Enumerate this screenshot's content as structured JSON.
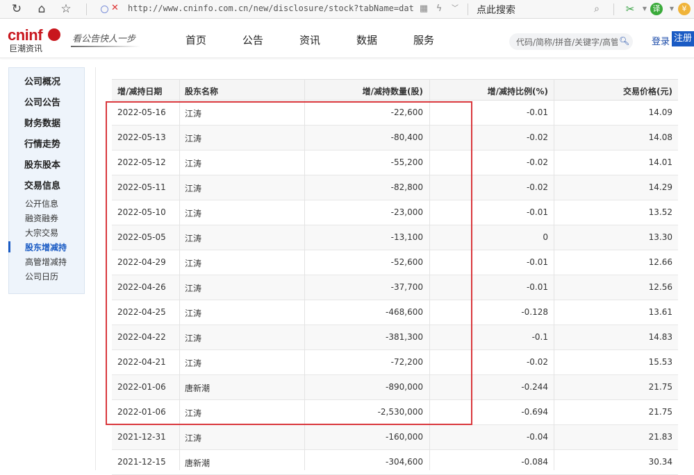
{
  "browser": {
    "url": "http://www.cninfo.com.cn/new/disclosure/stock?tabName=dat",
    "search_hint": "点此搜索"
  },
  "header": {
    "logo_text": "cninf",
    "logo_sub": "巨潮资讯",
    "slogan": "看公告快人一步",
    "nav": [
      "首页",
      "公告",
      "资讯",
      "数据",
      "服务"
    ],
    "search_placeholder": "代码/简称/拼音/关键字/高管",
    "login": "登录",
    "register": "注册"
  },
  "sidebar": {
    "main_items": [
      "公司概况",
      "公司公告",
      "财务数据",
      "行情走势",
      "股东股本",
      "交易信息"
    ],
    "sub_items": [
      "公开信息",
      "融资融券",
      "大宗交易",
      "股东增减持",
      "高管增减持",
      "公司日历"
    ],
    "active_sub": "股东增减持"
  },
  "table": {
    "columns": [
      "增/减持日期",
      "股东名称",
      "增/减持数量(股)",
      "增/减持比例(%)",
      "交易价格(元)"
    ],
    "rows": [
      [
        "2022-05-16",
        "江涛",
        "-22,600",
        "-0.01",
        "14.09"
      ],
      [
        "2022-05-13",
        "江涛",
        "-80,400",
        "-0.02",
        "14.08"
      ],
      [
        "2022-05-12",
        "江涛",
        "-55,200",
        "-0.02",
        "14.01"
      ],
      [
        "2022-05-11",
        "江涛",
        "-82,800",
        "-0.02",
        "14.29"
      ],
      [
        "2022-05-10",
        "江涛",
        "-23,000",
        "-0.01",
        "13.52"
      ],
      [
        "2022-05-05",
        "江涛",
        "-13,100",
        "0",
        "13.30"
      ],
      [
        "2022-04-29",
        "江涛",
        "-52,600",
        "-0.01",
        "12.66"
      ],
      [
        "2022-04-26",
        "江涛",
        "-37,700",
        "-0.01",
        "12.56"
      ],
      [
        "2022-04-25",
        "江涛",
        "-468,600",
        "-0.128",
        "13.61"
      ],
      [
        "2022-04-22",
        "江涛",
        "-381,300",
        "-0.1",
        "14.83"
      ],
      [
        "2022-04-21",
        "江涛",
        "-72,200",
        "-0.02",
        "15.53"
      ],
      [
        "2022-01-06",
        "唐新潮",
        "-890,000",
        "-0.244",
        "21.75"
      ],
      [
        "2022-01-06",
        "江涛",
        "-2,530,000",
        "-0.694",
        "21.75"
      ],
      [
        "2021-12-31",
        "江涛",
        "-160,000",
        "-0.04",
        "21.83"
      ],
      [
        "2021-12-15",
        "唐新潮",
        "-304,600",
        "-0.084",
        "30.34"
      ]
    ]
  },
  "colors": {
    "brand_red": "#c8161d",
    "accent_blue": "#1a5bc4",
    "highlight_red": "#d9363b"
  }
}
